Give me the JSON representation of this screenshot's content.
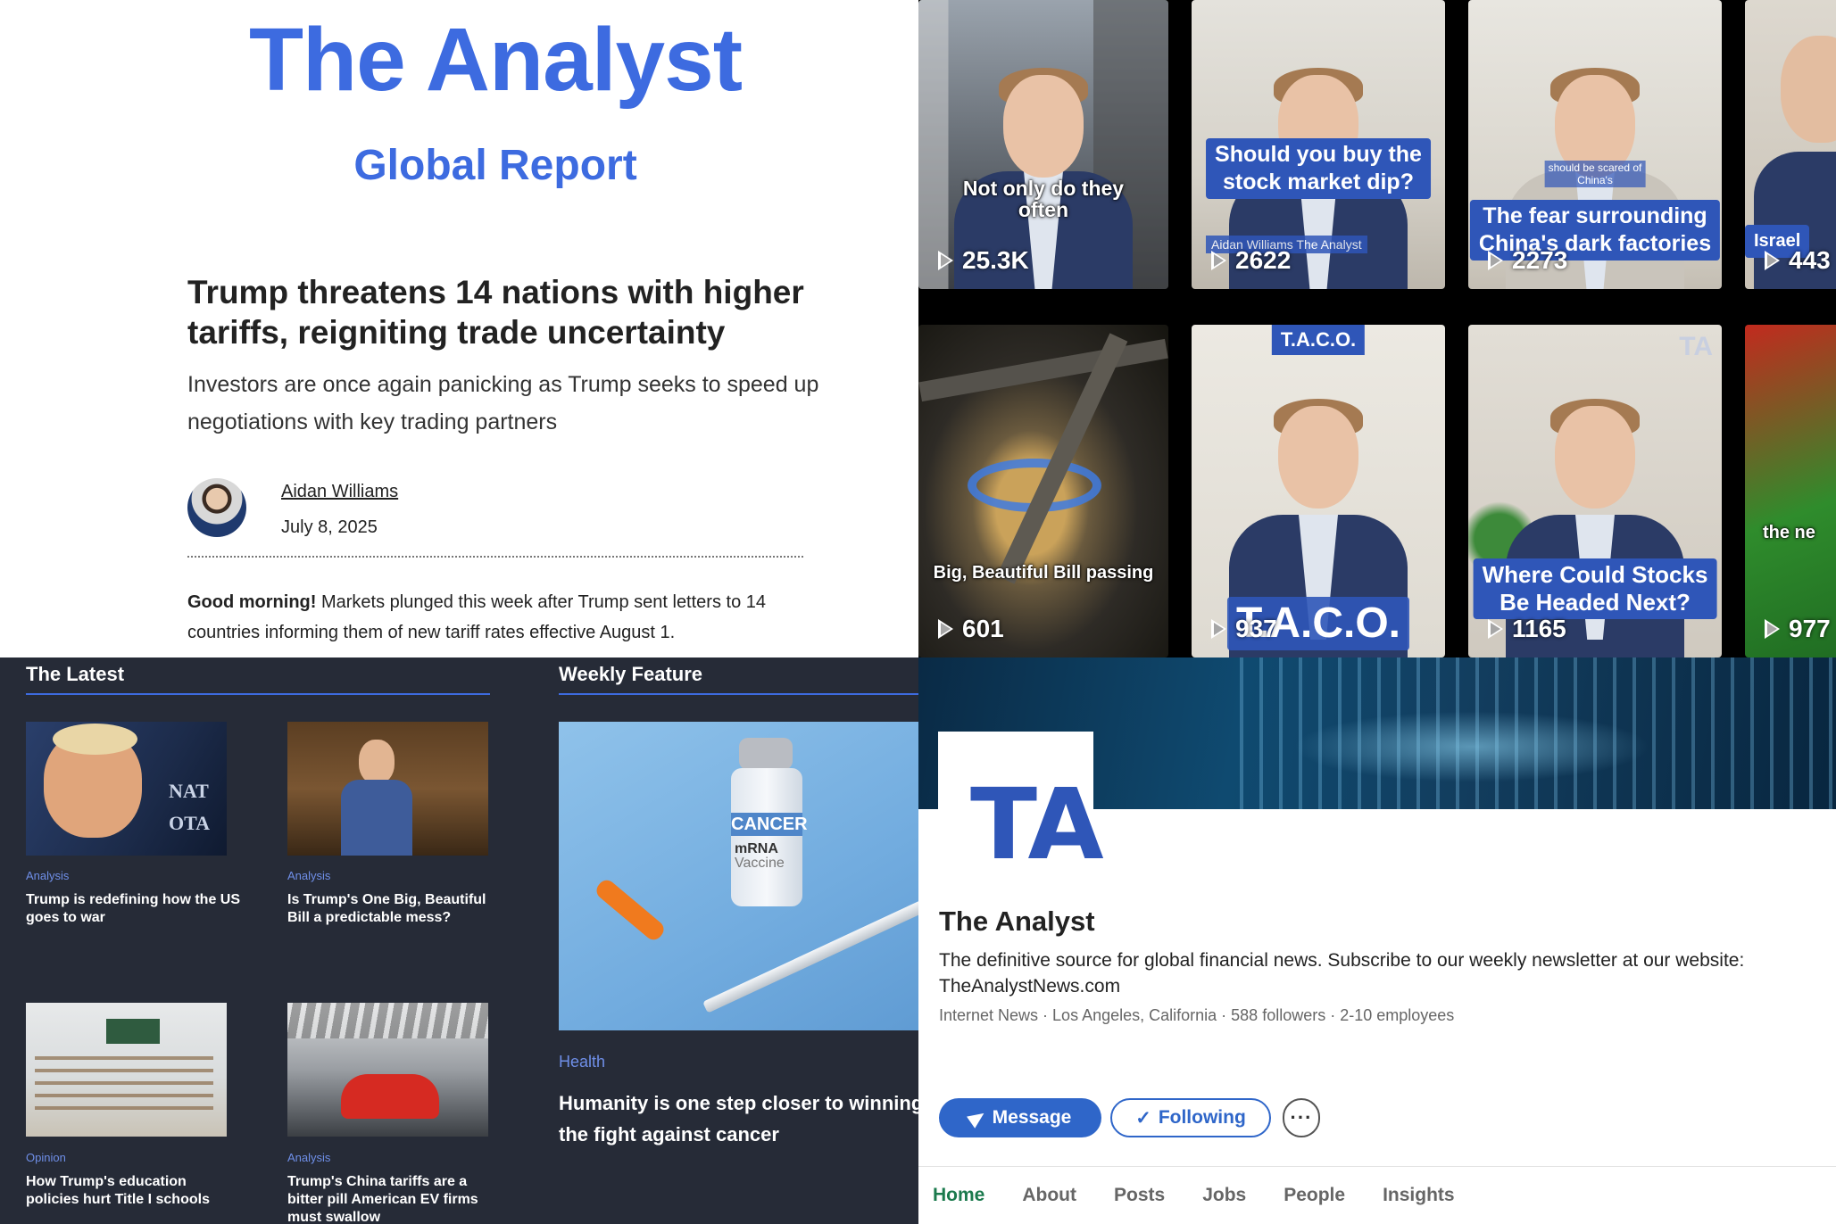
{
  "newsletter": {
    "brand": "The Analyst",
    "brand_sub": "Global Report",
    "headline": "Trump threatens 14 nations with higher tariffs, reigniting trade uncertainty",
    "dek": "Investors are once again panicking as Trump seeks to speed up negotiations with key trading partners",
    "author": "Aidan Williams",
    "date": "July 8, 2025",
    "intro_lead": "Good morning!",
    "intro_body": " Markets plunged this week after Trump sent letters to 14 countries informing them of new tariff rates effective August 1."
  },
  "videos": [
    {
      "caption": "Not only do they\noften",
      "caption_style": "plain",
      "views": "25.3K"
    },
    {
      "caption": "Should you buy the\nstock market dip?",
      "caption_style": "blue",
      "views": "2622",
      "overlay": "Aidan Williams  The Analyst"
    },
    {
      "caption": "The fear surrounding\nChina's dark factories",
      "caption_style": "blue",
      "views": "2273",
      "overlay": "should be scared of\nChina's"
    },
    {
      "caption": "Israel",
      "caption_style": "blue",
      "views": "443"
    },
    {
      "caption": "Big, Beautiful Bill passing",
      "caption_style": "plain",
      "views": "601"
    },
    {
      "caption": "T.A.C.O.",
      "caption_style": "blue",
      "views": "937",
      "top_tag": "T.A.C.O."
    },
    {
      "caption": "Where Could Stocks\nBe Headed Next?",
      "caption_style": "blue",
      "views": "1165",
      "mark": "TA"
    },
    {
      "caption": "the ne",
      "caption_style": "plain",
      "views": "977"
    }
  ],
  "news": {
    "latest_title": "The Latest",
    "feature_title": "Weekly Feature",
    "cards": [
      {
        "category": "Analysis",
        "headline": "Trump is redefining how the US goes to war"
      },
      {
        "category": "Analysis",
        "headline": "Is Trump's One Big, Beautiful Bill a predictable mess?"
      },
      {
        "category": "Opinion",
        "headline": "How Trump's education policies hurt Title I schools"
      },
      {
        "category": "Analysis",
        "headline": "Trump's China tariffs are a bitter pill American EV firms must swallow"
      }
    ],
    "card_image_text": {
      "nato_sign": "NAT\nOTA"
    },
    "feature": {
      "category": "Health",
      "headline": "Humanity is one step closer to winning the fight against cancer",
      "vial_label_1": "CANCER",
      "vial_label_2": "mRNA",
      "vial_label_3": "Vaccine"
    }
  },
  "profile": {
    "logo_text": "TA",
    "name": "The Analyst",
    "tagline": "The definitive source for global financial news. Subscribe to our weekly newsletter at our website: TheAnalystNews.com",
    "meta": "Internet News · Los Angeles, California · 588 followers · 2-10 employees",
    "message_label": "Message",
    "following_label": "Following",
    "more_label": "···",
    "tabs": [
      "Home",
      "About",
      "Posts",
      "Jobs",
      "People",
      "Insights"
    ],
    "active_tab": "Home"
  },
  "colors": {
    "brand_blue": "#3d6be0",
    "caption_blue": "#2f56b8",
    "dark_bg": "#262b37",
    "link_blue": "#6f8fe8",
    "active_green": "#1b7a4d"
  }
}
